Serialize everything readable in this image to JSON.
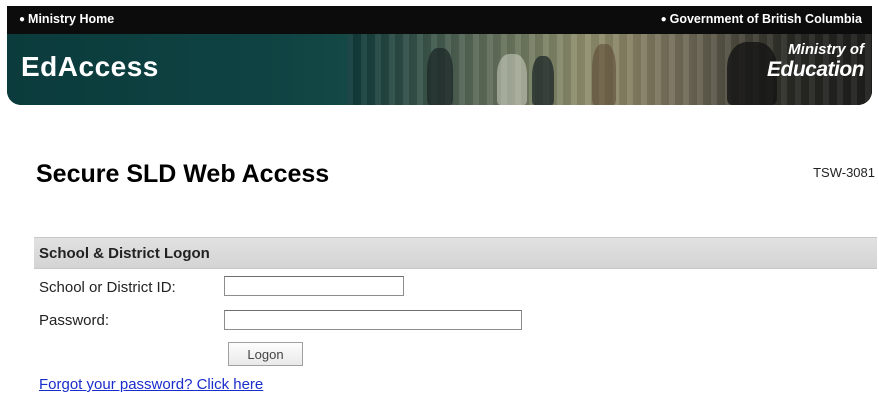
{
  "header": {
    "home_link": "Ministry Home",
    "gov_link": "Government of British Columbia",
    "app_title": "EdAccess",
    "ministry_logo_line1": "Ministry of",
    "ministry_logo_line2": "Education",
    "brand_color": "#0e3a3a"
  },
  "page": {
    "title": "Secure SLD Web Access",
    "code": "TSW-3081"
  },
  "logon": {
    "header": "School & District Logon",
    "id_label": "School or District ID:",
    "id_value": "",
    "password_label": "Password:",
    "password_value": "",
    "logon_button": "Logon",
    "forgot_link": "Forgot your password? Click here",
    "link_color": "#1a2ccc"
  }
}
